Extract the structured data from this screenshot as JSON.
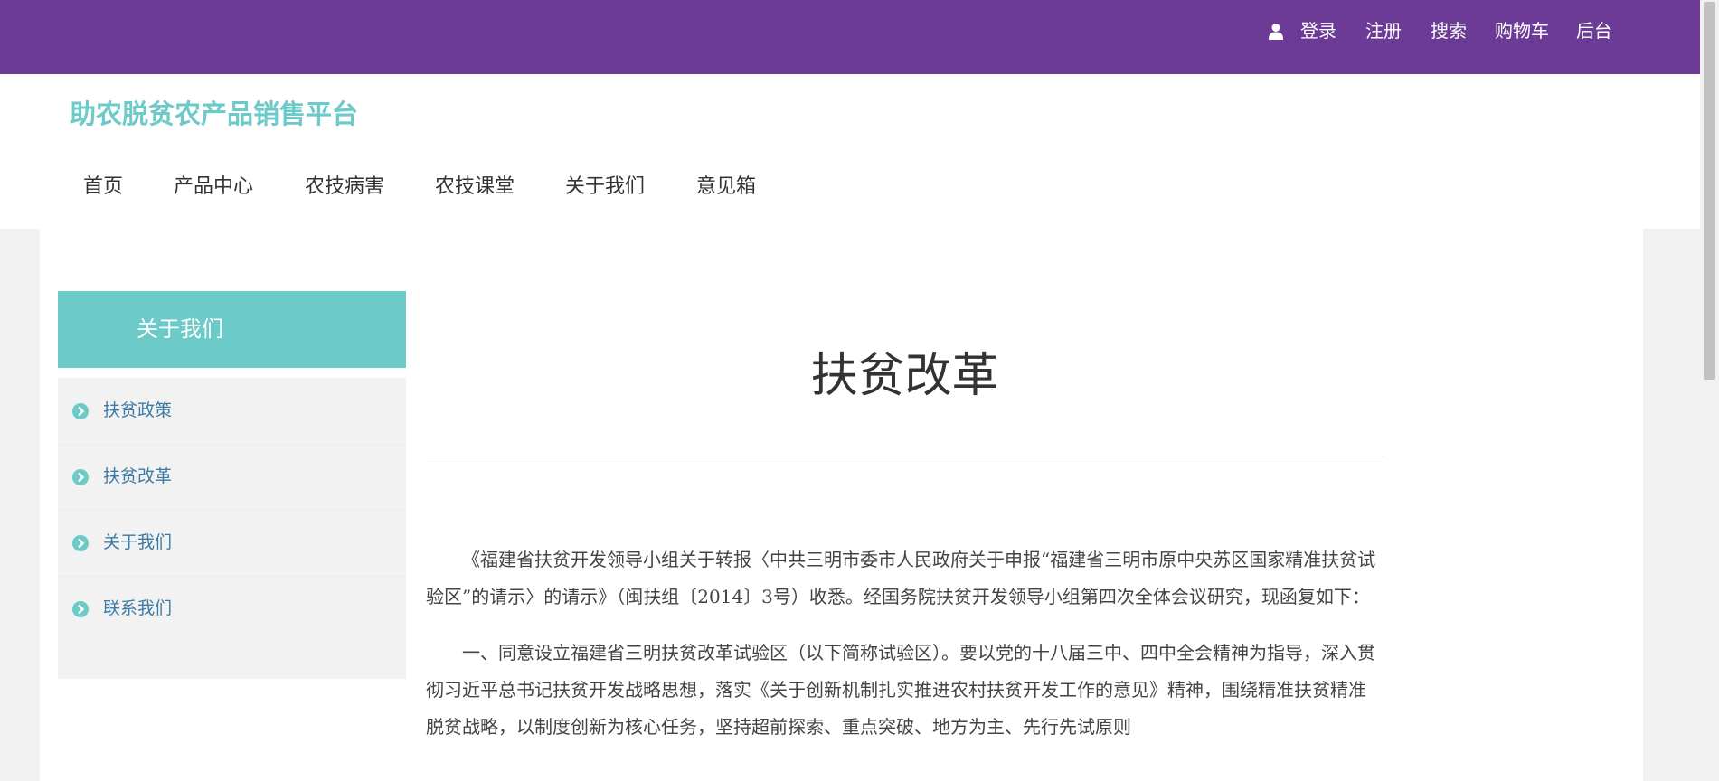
{
  "topbar": {
    "icon": "user-icon",
    "links": [
      "登录",
      "注册",
      "搜索",
      "购物车",
      "后台"
    ],
    "bg_color": "#6c3b96"
  },
  "header": {
    "logo": "助农脱贫农产品销售平台",
    "logo_color": "#6ccac9",
    "nav": [
      "首页",
      "产品中心",
      "农技病害",
      "农技课堂",
      "关于我们",
      "意见箱"
    ]
  },
  "sidebar": {
    "title": "关于我们",
    "items": [
      {
        "label": "扶贫政策",
        "icon": "chevron-right-circle-icon"
      },
      {
        "label": "扶贫改革",
        "icon": "chevron-right-circle-icon"
      },
      {
        "label": "关于我们",
        "icon": "chevron-right-circle-icon"
      },
      {
        "label": "联系我们",
        "icon": "chevron-right-circle-icon"
      }
    ]
  },
  "article": {
    "title": "扶贫改革",
    "paragraphs": [
      "《福建省扶贫开发领导小组关于转报〈中共三明市委市人民政府关于申报“福建省三明市原中央苏区国家精准扶贫试验区”的请示〉的请示》（闽扶组〔2014〕3号）收悉。经国务院扶贫开发领导小组第四次全体会议研究，现函复如下：",
      "一、同意设立福建省三明扶贫改革试验区（以下简称试验区）。要以党的十八届三中、四中全会精神为指导，深入贯彻习近平总书记扶贫开发战略思想，落实《关于创新机制扎实推进农村扶贫开发工作的意见》精神，围绕精准扶贫精准脱贫战略，以制度创新为核心任务，坚持超前探索、重点突破、地方为主、先行先试原则"
    ]
  }
}
